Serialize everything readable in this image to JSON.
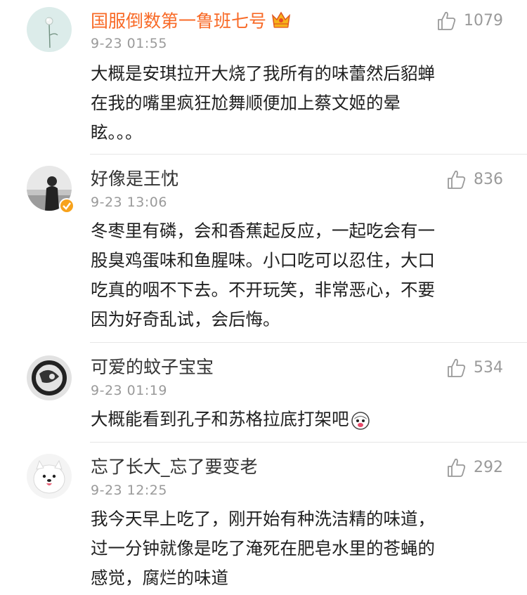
{
  "colors": {
    "vip_name": "#f86a27",
    "name": "#333333",
    "meta": "#9a9a9a",
    "text": "#1f1f1f",
    "divider": "#e6e6e6"
  },
  "comments": [
    {
      "username": "国服倒数第一鲁班七号",
      "vip_badge_icon": "crown-badge-icon",
      "timestamp": "9-23 01:55",
      "likes": "1079",
      "lines": [
        "大概是安琪拉开大烧了我所有的味蕾然后貂蝉",
        "在我的嘴里疯狂尬舞顺便加上蔡文姬的晕",
        "眩。。。"
      ]
    },
    {
      "username": "好像是王忱",
      "verified_icon": "verified-badge-icon",
      "timestamp": "9-23 13:06",
      "likes": "836",
      "lines": [
        "冬枣里有磷，会和香蕉起反应，一起吃会有一",
        "股臭鸡蛋味和鱼腥味。小口吃可以忍住，大口",
        "吃真的咽不下去。不开玩笑，非常恶心，不要",
        "因为好奇乱试，会后悔。"
      ]
    },
    {
      "username": "可爱的蚊子宝宝",
      "timestamp": "9-23 01:19",
      "likes": "534",
      "lines": [
        "大概能看到孔子和苏格拉底打架吧"
      ],
      "emoji_icon": "husky-emoji-icon"
    },
    {
      "username": "忘了长大_忘了要变老",
      "timestamp": "9-23 12:25",
      "likes": "292",
      "lines": [
        "我今天早上吃了，刚开始有种洗洁精的味道，",
        "过一分钟就像是吃了淹死在肥皂水里的苍蝇的",
        "感觉，腐烂的味道"
      ]
    }
  ]
}
